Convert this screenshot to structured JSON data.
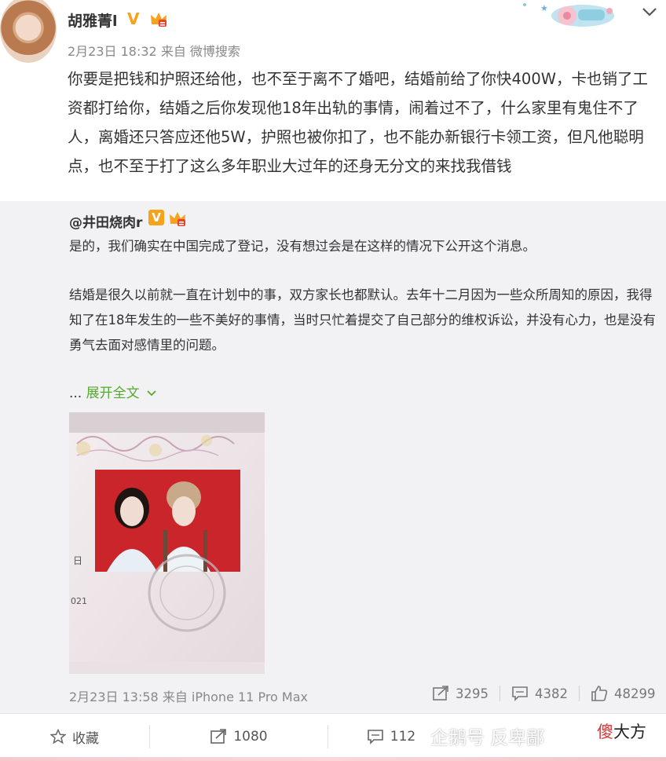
{
  "post": {
    "username": "胡雅菁l",
    "v_badge": "V",
    "meta": "2月23日 18:32 来自 微博搜索",
    "text": "你要是把钱和护照还给他，也不至于离不了婚吧，结婚前给了你快400W，卡也销了工资都打给你，结婚之后你发现他18年出轨的事情，闹着过不了，什么家里有鬼住不了人，离婚还只答应还他5W，护照也被你扣了，也不能办新银行卡领工资，但凡他聪明点，也不至于打了这么多年职业大过年的还身无分文的来找我借钱"
  },
  "retweet": {
    "username": "@井田烧肉r",
    "v_badge": "V",
    "paragraph1": "是的，我们确实在中国完成了登记，没有想过会是在这样的情况下公开这个消息。",
    "paragraph2": "结婚是很久以前就一直在计划中的事，双方家长也都默认。去年十二月因为一些众所周知的原因，我得知了在18年发生的一些不美好的事情，当时只忙着提交了自己部分的维权诉讼，并没有心力，也是没有勇气去面对感情里的问题。",
    "expand_prefix": "... ",
    "expand_label": "展开全文",
    "photo_text_ri": "日",
    "photo_text_year": "021",
    "meta": "2月23日 13:58 来自 iPhone 11 Pro Max",
    "stats": {
      "repost": "3295",
      "comment": "4382",
      "like": "48299"
    }
  },
  "footer": {
    "favorite_label": "收藏",
    "repost_count": "1080",
    "comment_count": "112",
    "watermark": "企鹅号 反卑鄙",
    "watermark2_red": "傻",
    "watermark2_rest": "大方"
  },
  "colors": {
    "accent_green": "#56a82e",
    "badge_orange": "#f7a21b",
    "retweet_bg": "#f2f2f5",
    "meta_gray": "#888888"
  },
  "icons": [
    "chevron-down-icon",
    "vip-badge-icon",
    "crown-icon",
    "repost-icon",
    "comment-icon",
    "like-icon",
    "star-icon"
  ]
}
